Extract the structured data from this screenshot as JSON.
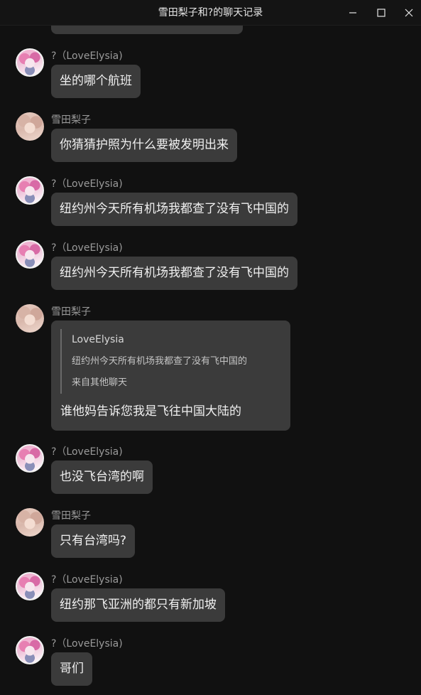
{
  "window": {
    "title": "雪田梨子和?的聊天记录",
    "controls": {
      "minimize_icon": "minimize-icon",
      "maximize_icon": "maximize-icon",
      "close_icon": "close-icon"
    }
  },
  "messages": [
    {
      "sender": "?（LoveElysia)",
      "text": "坐的哪个航班"
    },
    {
      "sender": "雪田梨子",
      "text": "你猜猜护照为什么要被发明出来"
    },
    {
      "sender": "?（LoveElysia)",
      "text": "纽约州今天所有机场我都查了没有飞中国的"
    },
    {
      "sender": "?（LoveElysia)",
      "text": "纽约州今天所有机场我都查了没有飞中国的"
    },
    {
      "sender": "雪田梨子",
      "quote": {
        "author": "LoveElysia",
        "text": "纽约州今天所有机场我都查了没有飞中国的",
        "source": "来自其他聊天"
      },
      "text": "谁他妈告诉您我是飞往中国大陆的"
    },
    {
      "sender": "?（LoveElysia)",
      "text": "也没飞台湾的啊"
    },
    {
      "sender": "雪田梨子",
      "text": "只有台湾吗?"
    },
    {
      "sender": "?（LoveElysia)",
      "text": "纽约那飞亚洲的都只有新加坡"
    },
    {
      "sender": "?（LoveElysia)",
      "text": "哥们"
    }
  ]
}
